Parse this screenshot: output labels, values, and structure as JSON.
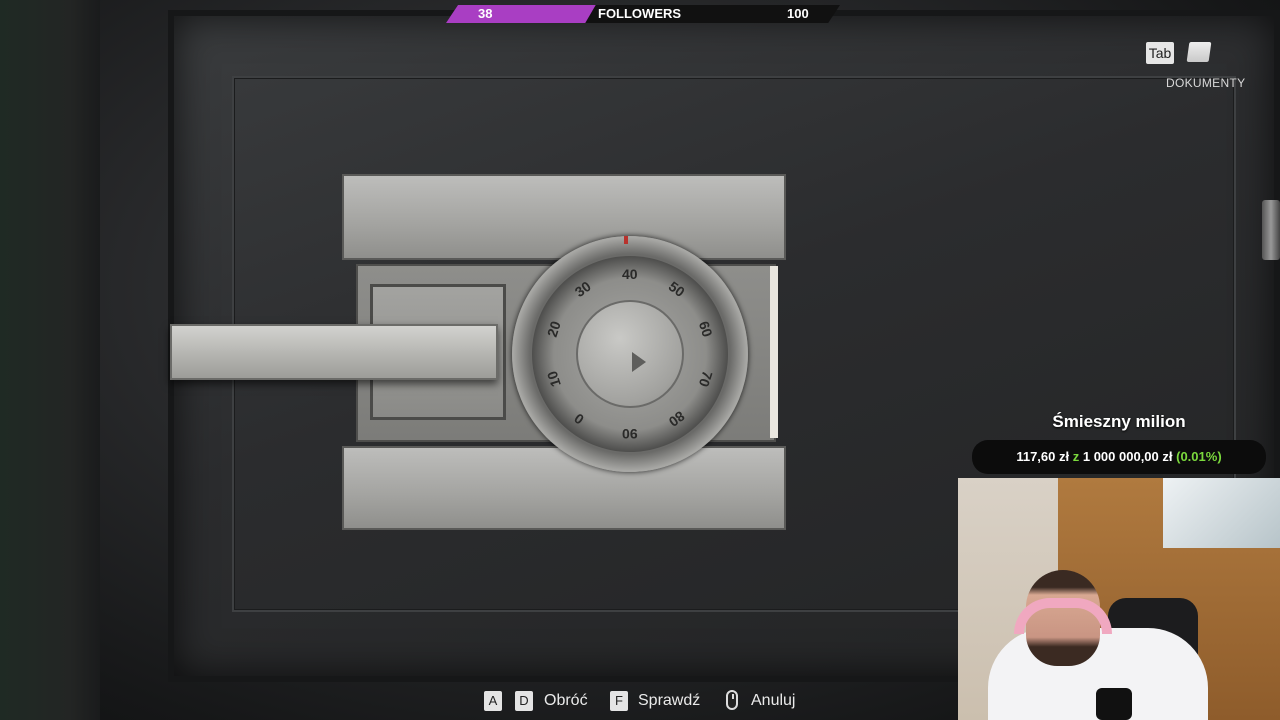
{
  "followers_bar": {
    "current": "38",
    "label": "FOLLOWERS",
    "goal": "100",
    "progress_fraction": 0.38,
    "fill_color": "#a93ec3"
  },
  "top_right_hint": {
    "key": "Tab",
    "icon": "document-icon",
    "label": "DOKUMENTY"
  },
  "challenge": {
    "title": "Śmieszny milion",
    "current": "117,60 zł",
    "separator": "z",
    "target": "1 000 000,00 zł",
    "percent": "(0.01%)",
    "accent_color": "#7bd93d"
  },
  "safe_dial": {
    "numbers": [
      "40",
      "50",
      "60",
      "70",
      "80",
      "90",
      "0",
      "10",
      "20",
      "30"
    ],
    "marker_color": "#b8322d"
  },
  "controls": {
    "key_a": "A",
    "key_d": "D",
    "rotate_label": "Obróć",
    "key_f": "F",
    "check_label": "Sprawdź",
    "cancel_icon": "mouse-right-click-icon",
    "cancel_label": "Anuluj"
  }
}
